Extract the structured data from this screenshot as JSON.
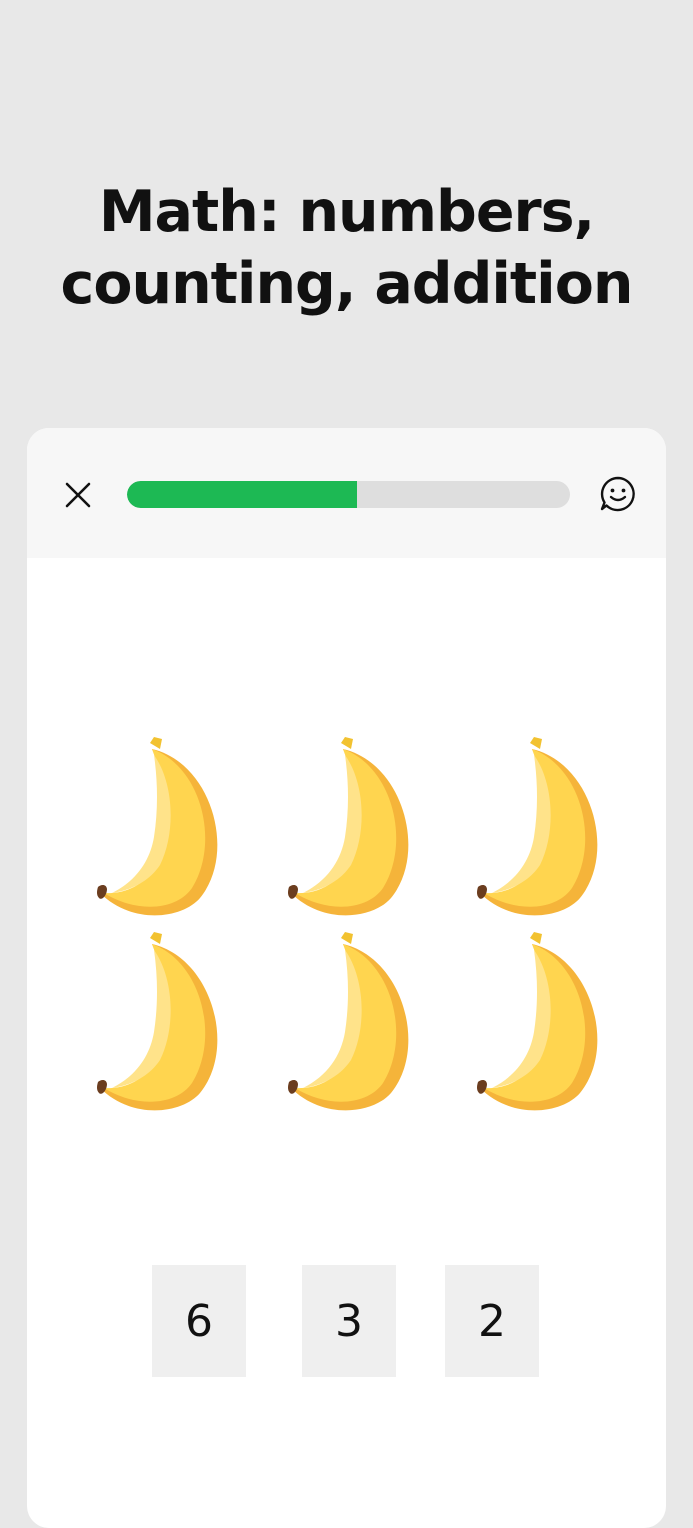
{
  "heading": {
    "line1": "Math: numbers,",
    "line2": "counting, addition"
  },
  "lesson": {
    "close_icon": "close-icon",
    "feedback_icon": "smiley-chat-icon",
    "progress_fraction": 0.52,
    "progress_color": "#1db954"
  },
  "question": {
    "item_icon": "banana-icon",
    "item_count": 6
  },
  "answers": [
    "6",
    "3",
    "2"
  ]
}
